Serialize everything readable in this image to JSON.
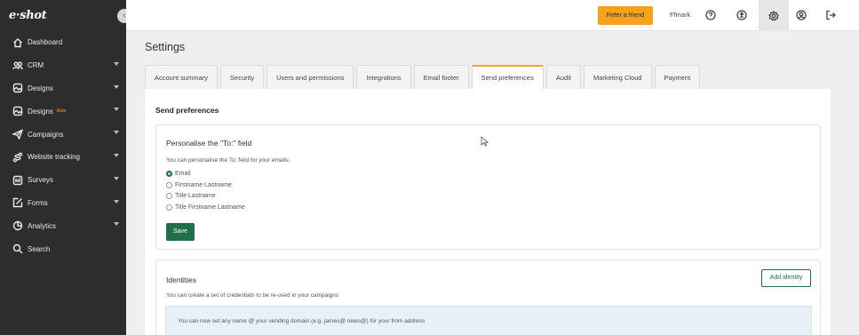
{
  "sidebar": {
    "logo": "e·shot",
    "collapse_glyph": "‹",
    "items": [
      {
        "label": "Dashboard",
        "icon": "home-icon",
        "has_caret": false
      },
      {
        "label": "CRM",
        "icon": "people-icon",
        "has_caret": true
      },
      {
        "label": "Designs",
        "icon": "palette-icon",
        "has_caret": true
      },
      {
        "label": "Designs",
        "icon": "palette-icon",
        "has_caret": true,
        "badge": "Beta"
      },
      {
        "label": "Campaigns",
        "icon": "paper-plane-icon",
        "has_caret": true
      },
      {
        "label": "Website tracking",
        "icon": "tracking-icon",
        "has_caret": true
      },
      {
        "label": "Surveys",
        "icon": "survey-icon",
        "has_caret": true
      },
      {
        "label": "Forms",
        "icon": "form-icon",
        "has_caret": true
      },
      {
        "label": "Analytics",
        "icon": "analytics-icon",
        "has_caret": true
      },
      {
        "label": "Search",
        "icon": "search-icon",
        "has_caret": false
      }
    ]
  },
  "topbar": {
    "refer_label": "Refer a friend",
    "username": "Ffmark",
    "icons": [
      "help-icon",
      "accessibility-icon",
      "settings-icon",
      "account-icon",
      "logout-icon"
    ]
  },
  "page": {
    "title": "Settings",
    "tabs": [
      "Account summary",
      "Security",
      "Users and permissions",
      "Integrations",
      "Email footer",
      "Send preferences",
      "Audit",
      "Marketing Cloud",
      "Payment"
    ],
    "active_tab": "Send preferences",
    "section_heading": "Send preferences"
  },
  "personalise": {
    "title": "Personalise the \"To:\" field",
    "description": "You can personalise the To: field for your emails:",
    "options": [
      "Email",
      "Firstname Lastname",
      "Title Lastname",
      "Title Firstname Lastname"
    ],
    "selected": "Email",
    "save_label": "Save"
  },
  "identities": {
    "title": "Identities",
    "description": "You can create a set of credentials to be re-used in your campaigns",
    "add_label": "Add identity",
    "info": "You can now set any name @ your sending domain (e.g. james@ news@) for your from address"
  },
  "colors": {
    "sidebar_bg": "#2d2d2d",
    "accent_orange": "#f7a21b",
    "primary_green": "#1f6f4a",
    "info_bg": "#e8f1f7"
  }
}
